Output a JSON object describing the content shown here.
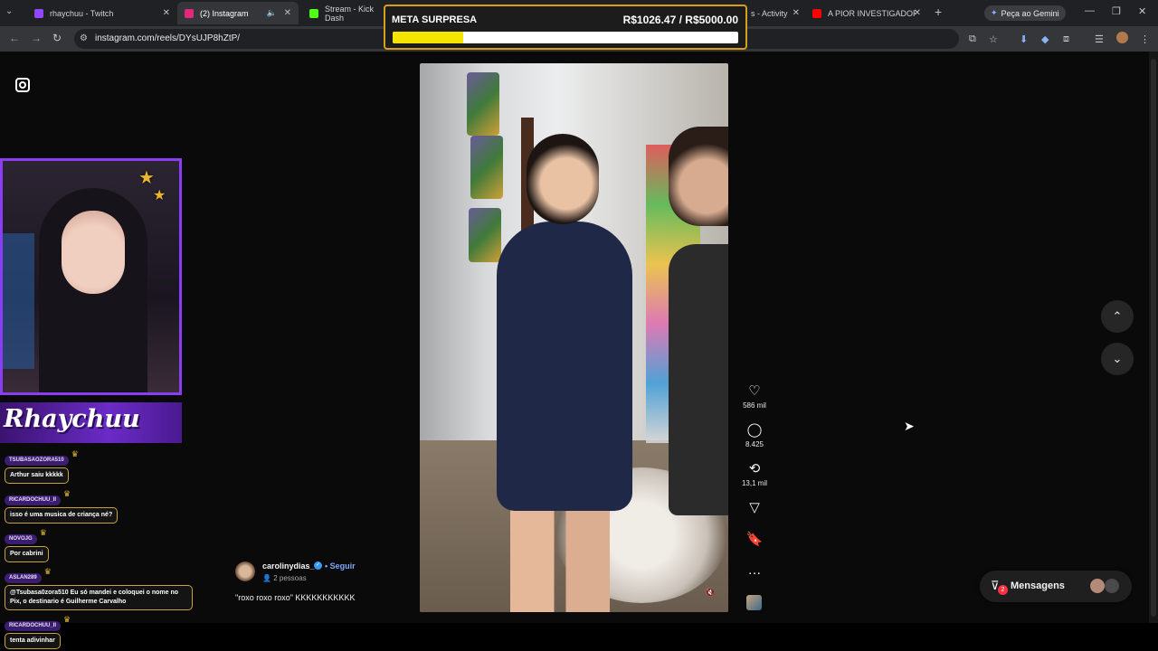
{
  "browser": {
    "tabs": [
      {
        "label": "rhaychuu - Twitch",
        "color": "#9146ff",
        "active": false
      },
      {
        "label": "(2) Instagram",
        "color": "#dd2a7b",
        "active": true
      },
      {
        "label": "Stream - Kick Dash",
        "color": "#53fc18",
        "active": false
      },
      {
        "label": "s - Activity",
        "color": "#5865f2",
        "active": false
      },
      {
        "label": "A PIOR INVESTIGADORA",
        "color": "#ff0000",
        "active": false
      }
    ],
    "gemini_label": "Peça ao Gemini",
    "url": "instagram.com/reels/DYsUJP8hZtP/"
  },
  "overlay_goal": {
    "label": "META SURPRESA",
    "amount": "R$1026.47 / R$5000.00",
    "progress": 0.205
  },
  "reel": {
    "likes": "586 mil",
    "comments": "8.425",
    "reposts": "13,1 mil",
    "author": "carolinydias_",
    "follow_label": "Seguir",
    "collab": "2 pessoas",
    "caption": "\"roxo roxo roxo\" KKKKKKKKKKK"
  },
  "messages": {
    "label": "Mensagens",
    "badge": "2"
  },
  "stream": {
    "brand_text": "Rhaychuu",
    "chat": [
      {
        "user": "TSUBASAOZORA510",
        "message": "Arthur saiu kkkkk"
      },
      {
        "user": "RICARDOCHUU_II",
        "message": "isso é uma musica de criança né?"
      },
      {
        "user": "NOVOJG",
        "message": "Por cabrini"
      },
      {
        "user": "ASLAN289",
        "message": "@Tsubasa0zora510 Eu só mandei e coloquei o nome no Pix, o destinario é Guilherme Carvalho"
      },
      {
        "user": "RICARDOCHUU_II",
        "message": "tenta adivinhar"
      }
    ]
  }
}
